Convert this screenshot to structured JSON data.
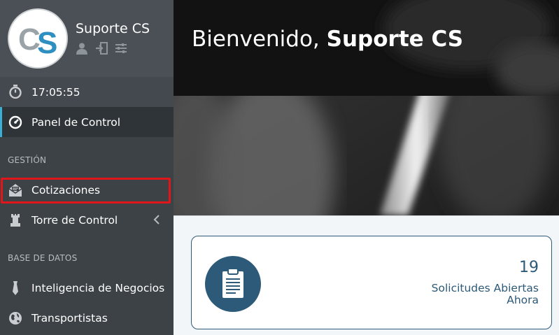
{
  "profile": {
    "logo_text": "CS",
    "username": "Suporte CS",
    "icons": [
      "user-icon",
      "logout-icon",
      "settings-sliders-icon"
    ]
  },
  "clock": {
    "time": "17:05:55",
    "icon": "stopwatch-icon"
  },
  "sidebar": {
    "items": [
      {
        "label": "Panel de Control",
        "icon": "dashboard-icon",
        "active": true
      },
      {
        "label": "Cotizaciones",
        "icon": "envelope-open-icon"
      },
      {
        "label": "Torre de Control",
        "icon": "chess-rook-icon",
        "has_submenu": true
      },
      {
        "label": "Inteligencia de Negocios",
        "icon": "tie-icon"
      },
      {
        "label": "Transportistas",
        "icon": "globe-icon"
      }
    ],
    "sections": [
      "GESTIÓN",
      "BASE DE DATOS"
    ]
  },
  "header": {
    "greeting": "Bienvenido, ",
    "name": "Suporte CS"
  },
  "stats": {
    "count": "19",
    "label": "Solicitudes Abiertas Ahora",
    "icon": "clipboard-icon"
  },
  "colors": {
    "sidebar_bg": "#3c4246",
    "accent": "#3aaed4",
    "highlight": "#e0161b",
    "stat_blue": "#2c5a78"
  }
}
